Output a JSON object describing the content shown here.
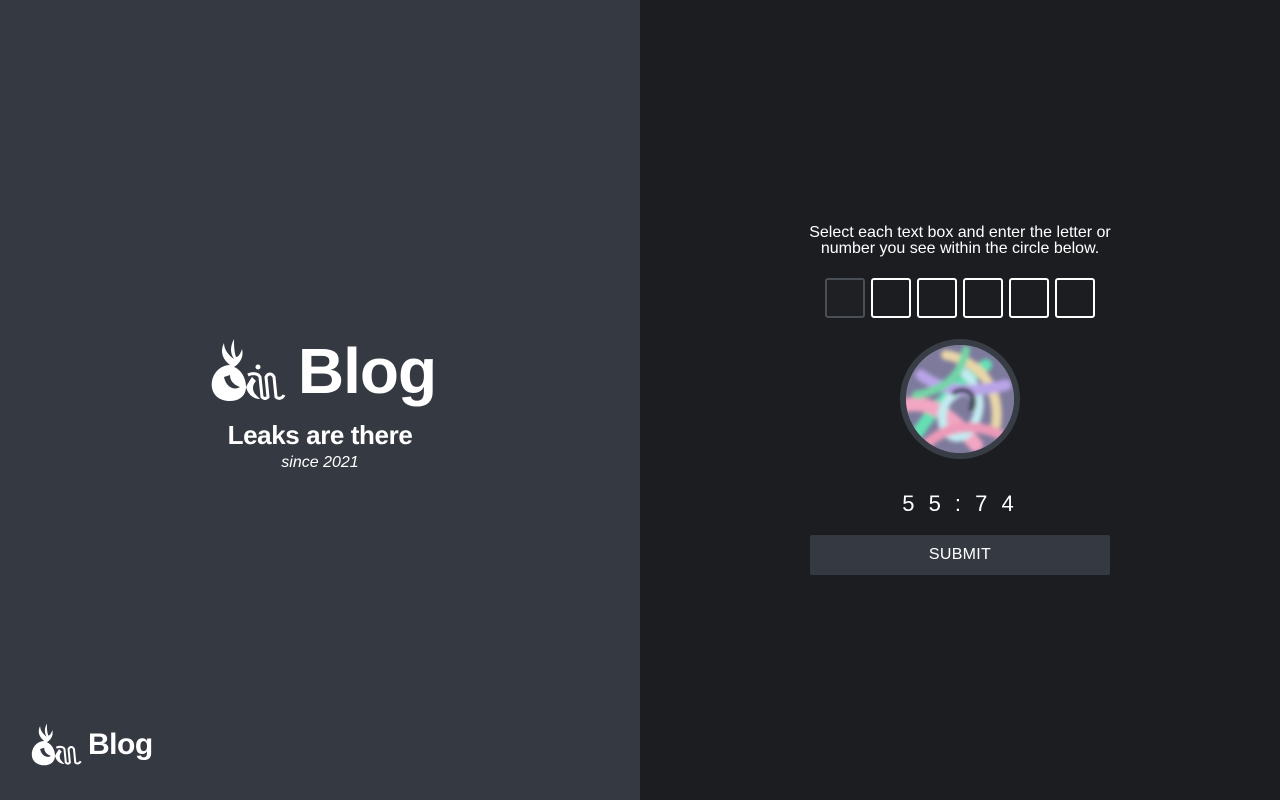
{
  "brand": {
    "title": "Blog",
    "tagline": "Leaks are there",
    "since": "since 2021",
    "logo_icon": "qilin-logo-icon"
  },
  "footer": {
    "title": "Blog",
    "logo_icon": "qilin-logo-icon"
  },
  "captcha": {
    "instructions": "Select each text box and enter the letter or number you see within the circle below.",
    "boxes": [
      "",
      "",
      "",
      "",
      "",
      ""
    ],
    "image_icon": "captcha-image",
    "timer": "55:74",
    "submit_label": "SUBMIT"
  },
  "colors": {
    "left_panel": "#353942",
    "right_panel": "#1b1d21",
    "text": "#ffffff",
    "button": "#353942"
  }
}
